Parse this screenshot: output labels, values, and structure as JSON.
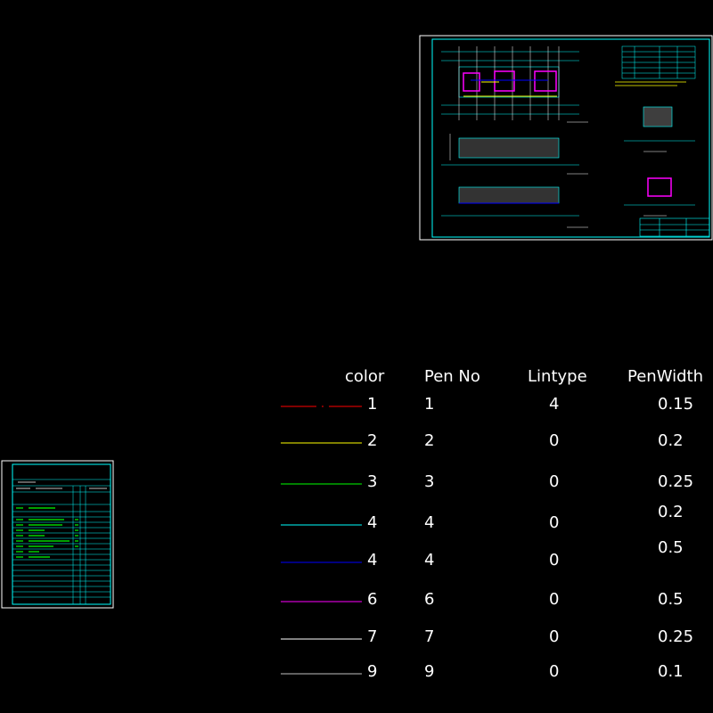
{
  "legend": {
    "headers": {
      "color": "color",
      "pen_no": "Pen No",
      "lintype": "Lintype",
      "pen_width": "PenWidth"
    },
    "rows": [
      {
        "color_label": "1",
        "pen_no": "1",
        "lintype": "4",
        "pen_width": "0.15",
        "line_color": "#ff0000",
        "dashed": true
      },
      {
        "color_label": "2",
        "pen_no": "2",
        "lintype": "0",
        "pen_width": "0.2",
        "line_color": "#ffff00",
        "dashed": false
      },
      {
        "color_label": "3",
        "pen_no": "3",
        "lintype": "0",
        "pen_width": "0.25",
        "line_color": "#00ff00",
        "dashed": false
      },
      {
        "color_label": "4",
        "pen_no": "4",
        "lintype": "0",
        "pen_width": "0.2",
        "line_color": "#00ffff",
        "dashed": false
      },
      {
        "color_label": "4",
        "pen_no": "4",
        "lintype": "0",
        "pen_width": "0.5",
        "line_color": "#0000ff",
        "dashed": false
      },
      {
        "color_label": "6",
        "pen_no": "6",
        "lintype": "0",
        "pen_width": "0.5",
        "line_color": "#ff00ff",
        "dashed": false
      },
      {
        "color_label": "7",
        "pen_no": "7",
        "lintype": "0",
        "pen_width": "0.25",
        "line_color": "#ffffff",
        "dashed": false
      },
      {
        "color_label": "9",
        "pen_no": "9",
        "lintype": "0",
        "pen_width": "0.1",
        "line_color": "#c0c0c0",
        "dashed": false
      }
    ]
  },
  "colors": {
    "background": "#000000",
    "frame": "#00ffff",
    "outline": "#ffffff"
  },
  "icons": [
    "drawing-sheet-thumbnail",
    "drawing-index-thumbnail"
  ]
}
